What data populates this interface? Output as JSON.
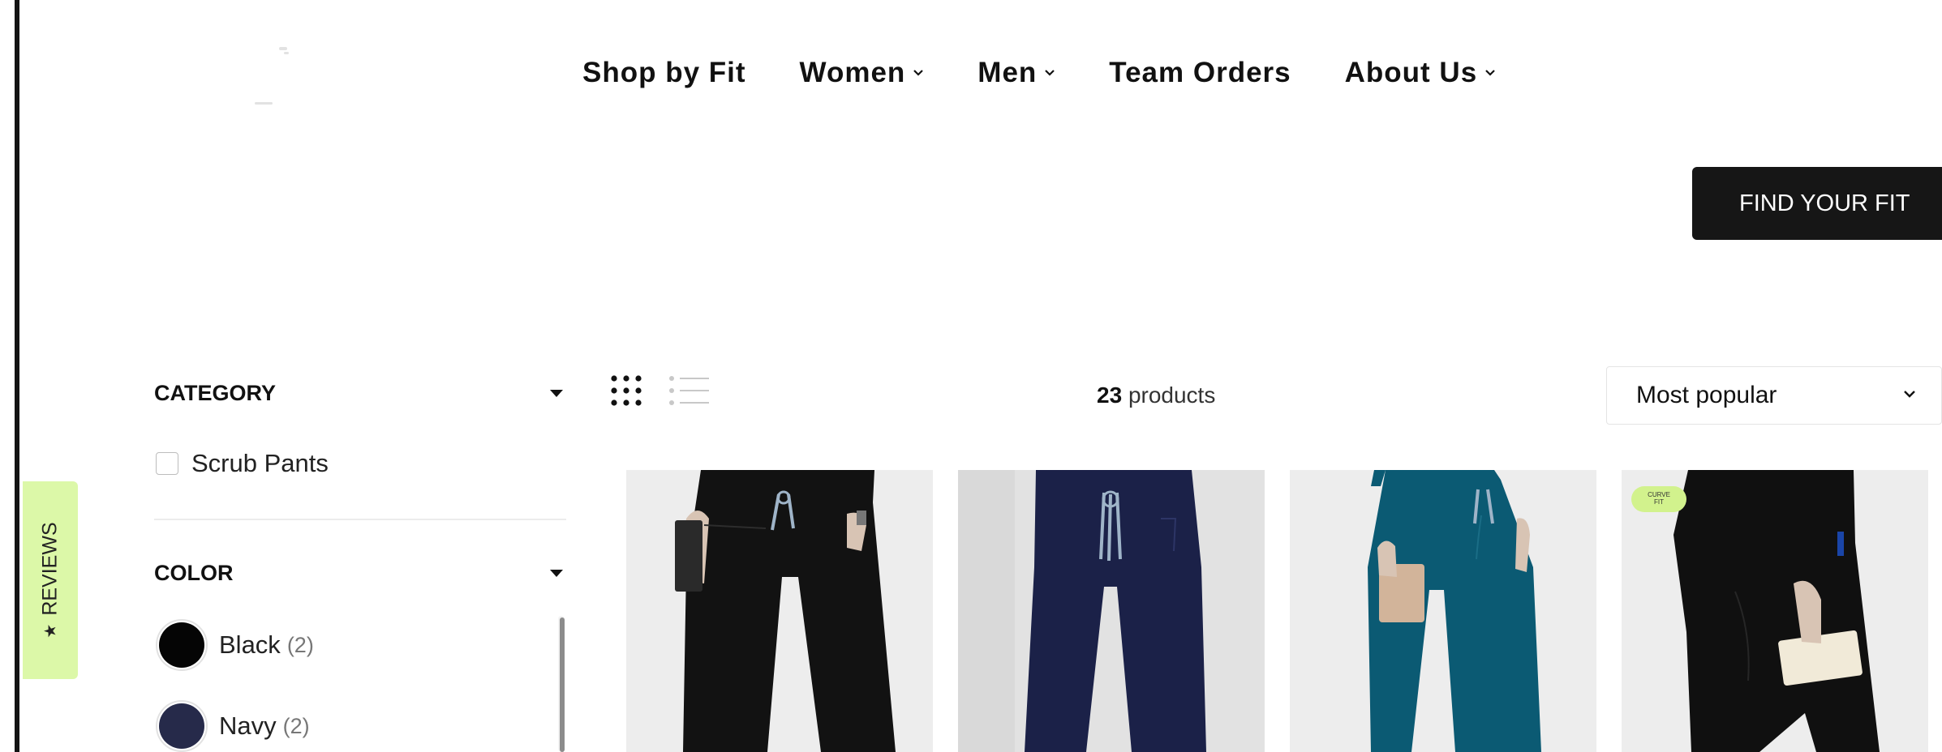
{
  "nav": {
    "items": [
      {
        "label": "Shop by Fit",
        "has_dropdown": false
      },
      {
        "label": "Women",
        "has_dropdown": true
      },
      {
        "label": "Men",
        "has_dropdown": true
      },
      {
        "label": "Team Orders",
        "has_dropdown": false
      },
      {
        "label": "About Us",
        "has_dropdown": true
      }
    ]
  },
  "find_fit_button": "FIND YOUR FIT",
  "reviews_tab": {
    "label": "REVIEWS",
    "icon": "star-icon",
    "color": "#dcf8a8"
  },
  "filters": {
    "category": {
      "title": "CATEGORY",
      "options": [
        {
          "label": "Scrub Pants",
          "checked": false
        }
      ]
    },
    "color": {
      "title": "COLOR",
      "options": [
        {
          "label": "Black",
          "count": "(2)",
          "swatch": "#050505"
        },
        {
          "label": "Navy",
          "count": "(2)",
          "swatch": "#262a4a"
        }
      ]
    }
  },
  "toolbar": {
    "count": "23",
    "count_suffix": "products",
    "sort_selected": "Most popular",
    "view_modes": [
      "grid-view-icon",
      "list-view-icon"
    ],
    "active_view": "grid-view-icon"
  },
  "products": [
    {
      "image": "black scrub pants",
      "pant_color": "#121212",
      "badge": ""
    },
    {
      "image": "navy scrub pants",
      "pant_color": "#1b2148",
      "badge": ""
    },
    {
      "image": "teal scrub pants",
      "pant_color": "#0b5a73",
      "badge": ""
    },
    {
      "image": "black curve fit scrub pants",
      "pant_color": "#101010",
      "badge_line1": "CURVE",
      "badge_line2": "FIT"
    }
  ]
}
